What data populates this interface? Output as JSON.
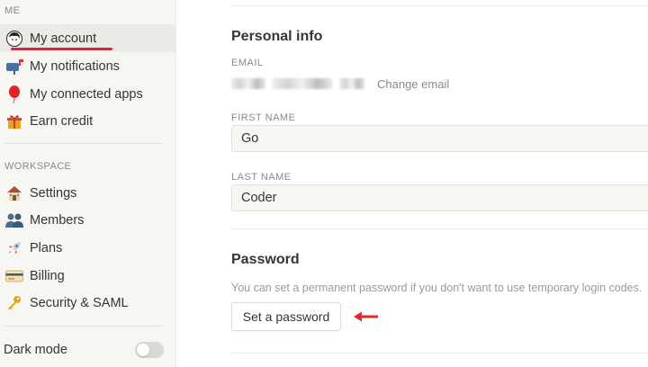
{
  "sidebar": {
    "section_me": "ME",
    "section_workspace": "WORKSPACE",
    "me_items": [
      {
        "label": "My account",
        "icon": "avatar-icon",
        "active": true
      },
      {
        "label": "My notifications",
        "icon": "mailbox-icon"
      },
      {
        "label": "My connected apps",
        "icon": "balloon-icon"
      },
      {
        "label": "Earn credit",
        "icon": "gift-icon"
      }
    ],
    "workspace_items": [
      {
        "label": "Settings",
        "icon": "house-icon"
      },
      {
        "label": "Members",
        "icon": "people-icon"
      },
      {
        "label": "Plans",
        "icon": "rocket-icon"
      },
      {
        "label": "Billing",
        "icon": "credit-card-icon"
      },
      {
        "label": "Security & SAML",
        "icon": "key-icon"
      }
    ],
    "dark_mode": {
      "label": "Dark mode",
      "enabled": false
    }
  },
  "main": {
    "personal_info": {
      "title": "Personal info",
      "email_label": "EMAIL",
      "change_email": "Change email",
      "first_name_label": "FIRST NAME",
      "first_name": "Go",
      "last_name_label": "LAST NAME",
      "last_name": "Coder"
    },
    "password": {
      "title": "Password",
      "hint": "You can set a permanent password if you don't want to use temporary login codes.",
      "button": "Set a password"
    }
  },
  "colors": {
    "annotation_red": "#e5252a",
    "sidebar_bg": "#f7f6f3"
  }
}
